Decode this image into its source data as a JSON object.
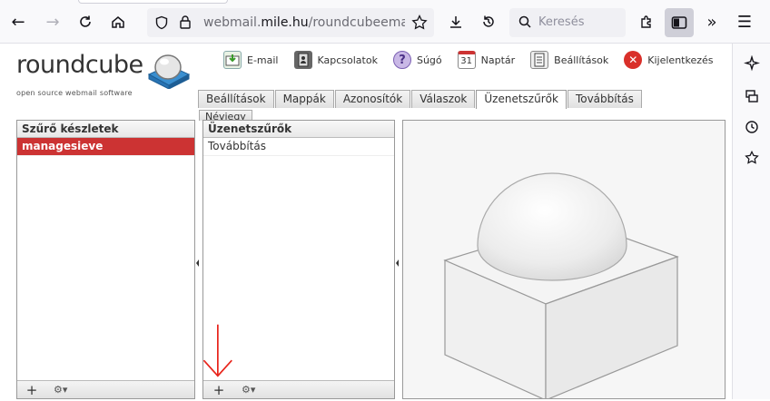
{
  "browser": {
    "url_prefix": "webmail.",
    "url_domain": "mile.hu",
    "url_rest": "/roundcubeemail/?_ta",
    "search_placeholder": "Keresés"
  },
  "app": {
    "logo_text": "roundcube",
    "logo_subtitle": "open source webmail software"
  },
  "taskbar": [
    {
      "label": "E-mail",
      "icon": "mail-icon"
    },
    {
      "label": "Kapcsolatok",
      "icon": "addressbook-icon"
    },
    {
      "label": "Súgó",
      "icon": "help-icon"
    },
    {
      "label": "Naptár",
      "icon": "calendar-icon"
    },
    {
      "label": "Beállítások",
      "icon": "settings-icon"
    },
    {
      "label": "Kijelentkezés",
      "icon": "logout-icon"
    }
  ],
  "calendar_day": "31",
  "tabs": [
    "Beállítások",
    "Mappák",
    "Azonosítók",
    "Válaszok",
    "Üzenetszűrők",
    "Továbbítás"
  ],
  "selected_tab": "Üzenetszűrők",
  "tab_row2": [
    "Névjegy"
  ],
  "filtersets_panel": {
    "title": "Szűrő készletek",
    "items": [
      "managesieve"
    ]
  },
  "filters_panel": {
    "title": "Üzenetszűrők",
    "items": [
      "Továbbítás"
    ]
  },
  "footer": {
    "add_symbol": "+",
    "gear_symbol": "⚙▾"
  },
  "colors": {
    "selected_row": "#cc3333",
    "annotation_arrow": "#e8241b"
  }
}
